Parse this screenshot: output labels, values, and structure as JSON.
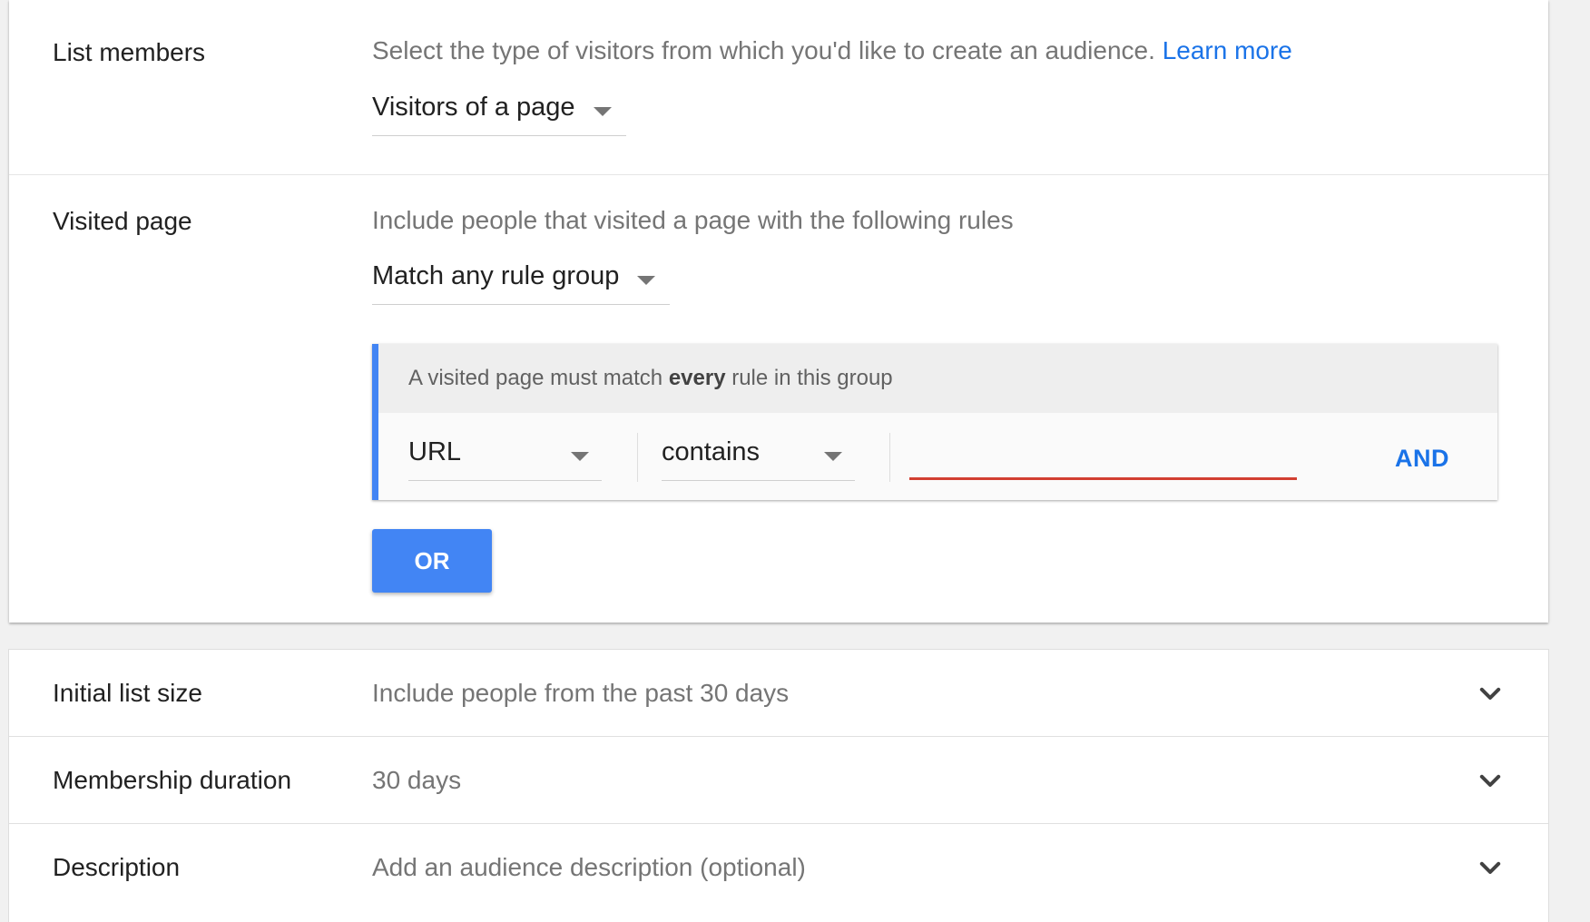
{
  "list_members": {
    "label": "List members",
    "description": "Select the type of visitors from which you'd like to create an audience.",
    "learn_more": "Learn more",
    "selected": "Visitors of a page"
  },
  "visited_page": {
    "label": "Visited page",
    "description": "Include people that visited a page with the following rules",
    "match_selected": "Match any rule group",
    "rule_group": {
      "header_prefix": "A visited page must match",
      "header_bold": "every",
      "header_suffix": "rule in this group",
      "rules": [
        {
          "field": "URL",
          "operator": "contains",
          "value": ""
        }
      ],
      "and_label": "AND"
    },
    "or_label": "OR"
  },
  "settings": {
    "initial_list_size": {
      "label": "Initial list size",
      "value": "Include people from the past 30 days"
    },
    "membership_duration": {
      "label": "Membership duration",
      "value": "30 days"
    },
    "description": {
      "label": "Description",
      "value": "Add an audience description (optional)"
    }
  },
  "colors": {
    "accent_blue": "#4285f4",
    "link_blue": "#1a73e8",
    "error_red": "#d23f31"
  }
}
